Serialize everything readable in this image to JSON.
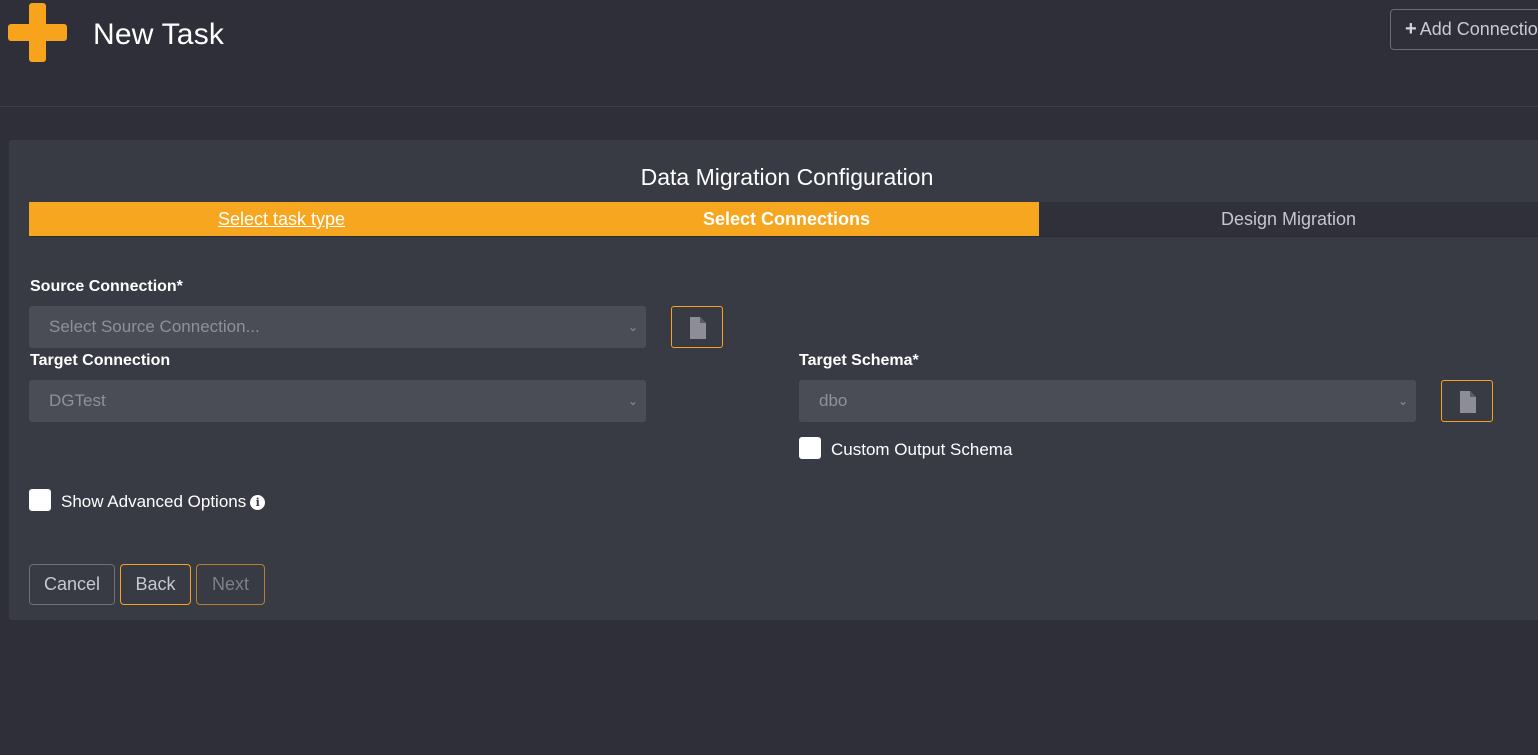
{
  "header": {
    "title": "New Task",
    "add_connection_label": "Add Connection",
    "accent_color": "#f7a41c"
  },
  "panel": {
    "title": "Data Migration Configuration",
    "steps": [
      {
        "label": "Select task type",
        "state": "done"
      },
      {
        "label": "Select Connections",
        "state": "active"
      },
      {
        "label": "Design Migration",
        "state": "pending"
      }
    ]
  },
  "form": {
    "source_connection": {
      "label": "Source Connection*",
      "placeholder": "Select Source Connection...",
      "icon": "file-icon"
    },
    "target_connection": {
      "label": "Target Connection",
      "value": "DGTest"
    },
    "target_schema": {
      "label": "Target Schema*",
      "value": "dbo",
      "icon": "file-icon"
    },
    "custom_output_schema": {
      "label": "Custom Output Schema",
      "checked": false
    },
    "show_advanced_options": {
      "label": "Show Advanced Options",
      "checked": false,
      "icon": "info-icon"
    }
  },
  "footer": {
    "cancel_label": "Cancel",
    "back_label": "Back",
    "next_label": "Next"
  }
}
